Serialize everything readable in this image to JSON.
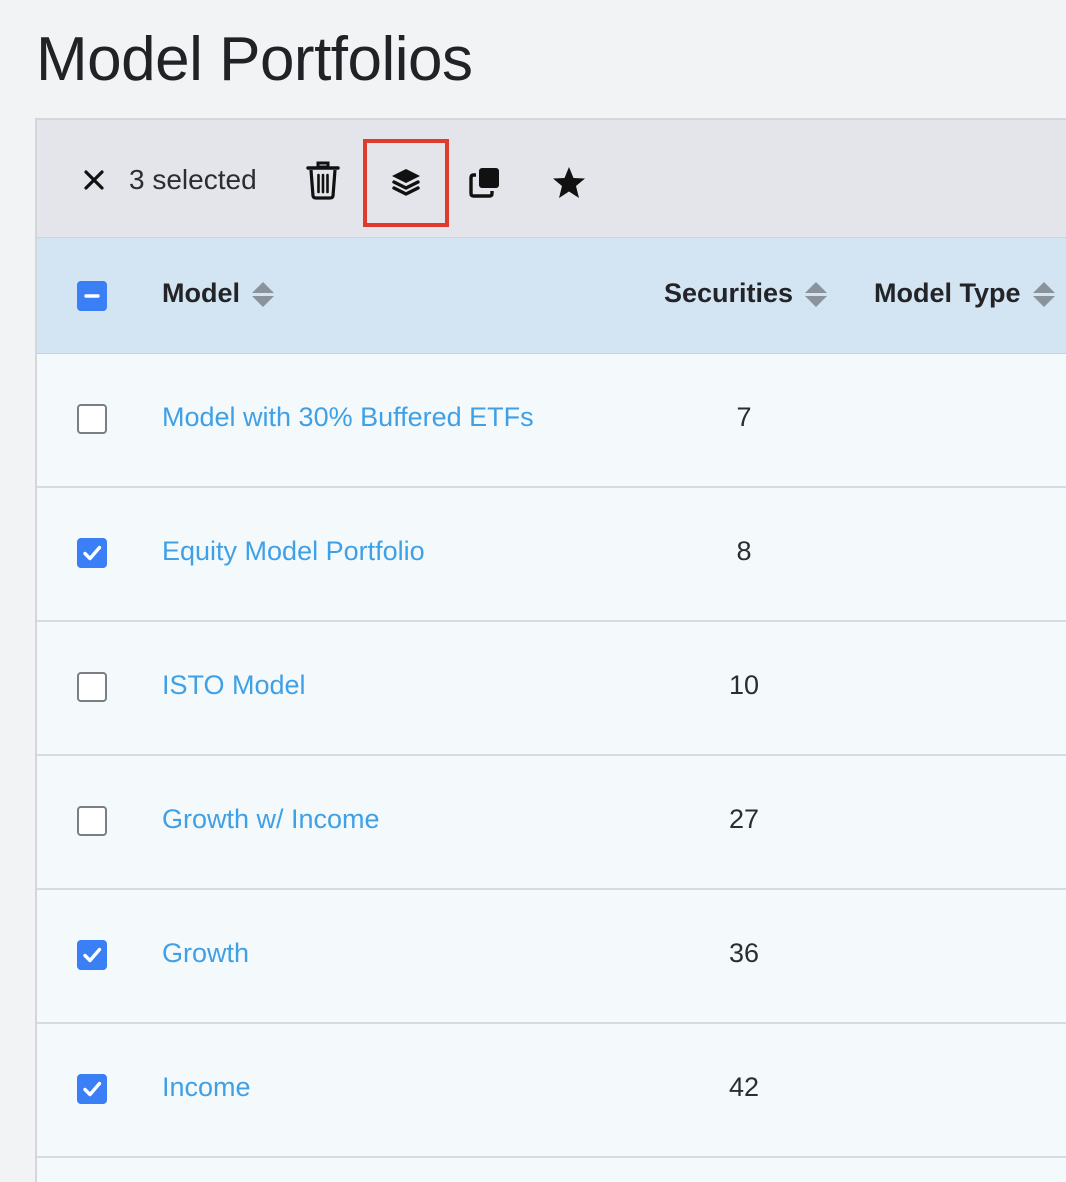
{
  "page": {
    "title": "Model Portfolios"
  },
  "toolbar": {
    "selected_label": "3 selected",
    "actions": [
      {
        "name": "close-icon"
      },
      {
        "name": "trash-icon"
      },
      {
        "name": "layers-icon",
        "highlighted": true,
        "highlight_color": "#e03a2e"
      },
      {
        "name": "copy-icon"
      },
      {
        "name": "star-icon"
      }
    ]
  },
  "table": {
    "header_checkbox_state": "indeterminate",
    "columns": [
      {
        "label": "Model",
        "sortable": true
      },
      {
        "label": "Securities",
        "sortable": true
      },
      {
        "label": "Model Type",
        "sortable": true
      }
    ],
    "rows": [
      {
        "checked": false,
        "model": "Model with 30% Buffered ETFs",
        "securities": "7",
        "model_type": ""
      },
      {
        "checked": true,
        "model": "Equity Model Portfolio",
        "securities": "8",
        "model_type": ""
      },
      {
        "checked": false,
        "model": "ISTO Model",
        "securities": "10",
        "model_type": ""
      },
      {
        "checked": false,
        "model": "Growth w/ Income",
        "securities": "27",
        "model_type": ""
      },
      {
        "checked": true,
        "model": "Growth",
        "securities": "36",
        "model_type": ""
      },
      {
        "checked": true,
        "model": "Income",
        "securities": "42",
        "model_type": ""
      }
    ]
  },
  "colors": {
    "accent": "#3a7ff6",
    "link": "#3fa0e6",
    "header_bg": "#d3e4f2",
    "toolbar_bg": "#e3e5ea",
    "row_bg": "#f4f9fc"
  }
}
